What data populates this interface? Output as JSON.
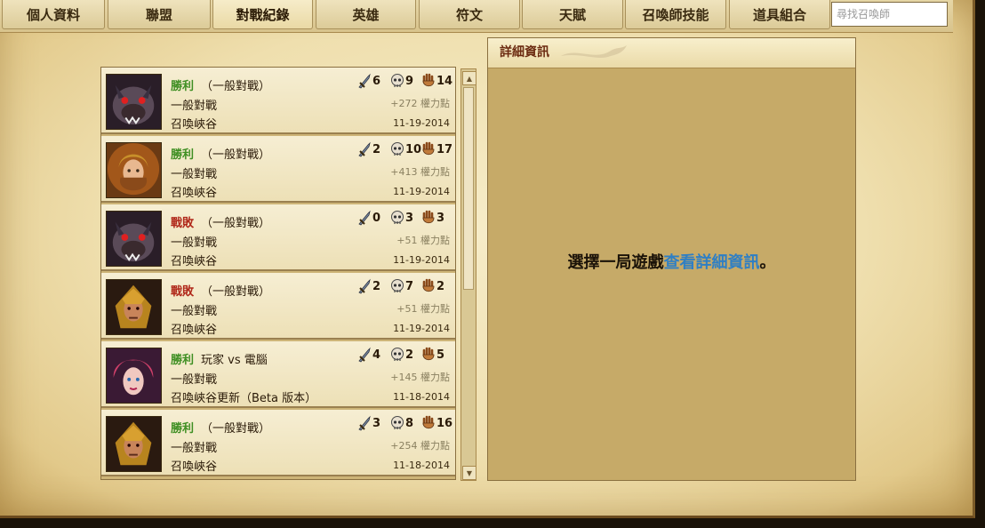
{
  "tabs": [
    {
      "label": "個人資料"
    },
    {
      "label": "聯盟"
    },
    {
      "label": "對戰紀錄",
      "active": true
    },
    {
      "label": "英雄"
    },
    {
      "label": "符文"
    },
    {
      "label": "天賦"
    },
    {
      "label": "召喚師技能"
    },
    {
      "label": "道具組合"
    }
  ],
  "search": {
    "placeholder": "尋找召喚師"
  },
  "matches": [
    {
      "result": "勝利",
      "outcome": "win",
      "mode": "（一般對戰）",
      "type": "一般對戰",
      "map": "召喚峽谷",
      "kills": "6",
      "deaths": "9",
      "assists": "14",
      "ip": "+272 權力點",
      "date": "11-19-2014",
      "portrait": "warwick"
    },
    {
      "result": "勝利",
      "outcome": "win",
      "mode": "（一般對戰）",
      "type": "一般對戰",
      "map": "召喚峽谷",
      "kills": "2",
      "deaths": "10",
      "assists": "17",
      "ip": "+413 權力點",
      "date": "11-19-2014",
      "portrait": "mage"
    },
    {
      "result": "戰敗",
      "outcome": "loss",
      "mode": "（一般對戰）",
      "type": "一般對戰",
      "map": "召喚峽谷",
      "kills": "0",
      "deaths": "3",
      "assists": "3",
      "ip": "+51 權力點",
      "date": "11-19-2014",
      "portrait": "warwick"
    },
    {
      "result": "戰敗",
      "outcome": "loss",
      "mode": "（一般對戰）",
      "type": "一般對戰",
      "map": "召喚峽谷",
      "kills": "2",
      "deaths": "7",
      "assists": "2",
      "ip": "+51 權力點",
      "date": "11-19-2014",
      "portrait": "xin"
    },
    {
      "result": "勝利",
      "outcome": "win",
      "mode": "玩家 vs 電腦",
      "type": "一般對戰",
      "map": "召喚峽谷更新（Beta 版本）",
      "kills": "4",
      "deaths": "2",
      "assists": "5",
      "ip": "+145 權力點",
      "date": "11-18-2014",
      "portrait": "vi"
    },
    {
      "result": "勝利",
      "outcome": "win",
      "mode": "（一般對戰）",
      "type": "一般對戰",
      "map": "召喚峽谷",
      "kills": "3",
      "deaths": "8",
      "assists": "16",
      "ip": "+254 權力點",
      "date": "11-18-2014",
      "portrait": "xin"
    }
  ],
  "detail": {
    "title": "詳細資訊",
    "hint_prefix": "選擇一局遊戲",
    "hint_link": "查看詳細資訊",
    "hint_suffix": "。"
  },
  "colors": {
    "win": "#3f8f23",
    "loss": "#b0281a",
    "link": "#2f7fc4",
    "title": "#6b2a10"
  }
}
